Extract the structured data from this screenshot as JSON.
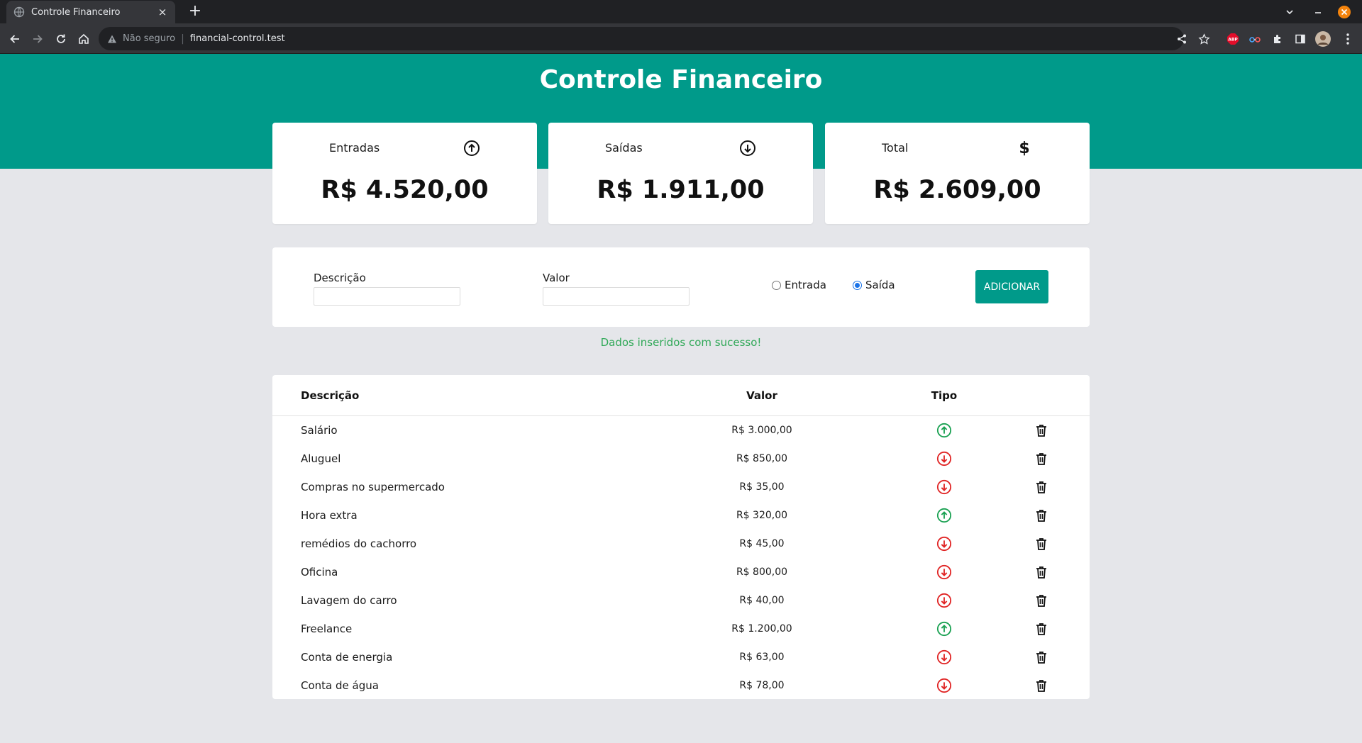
{
  "browser": {
    "tab_title": "Controle Financeiro",
    "tab_close": "×",
    "new_tab": "+",
    "security_label": "Não seguro",
    "url": "financial-control.test",
    "extension_badge": "ABP"
  },
  "header": {
    "title": "Controle Financeiro"
  },
  "summary": [
    {
      "label": "Entradas",
      "icon": "arrow-up-circle-icon",
      "value": "R$ 4.520,00"
    },
    {
      "label": "Saídas",
      "icon": "arrow-down-circle-icon",
      "value": "R$ 1.911,00"
    },
    {
      "label": "Total",
      "icon": "dollar-sign-icon",
      "icon_glyph": "$",
      "value": "R$ 2.609,00"
    }
  ],
  "form": {
    "description_label": "Descrição",
    "description_value": "",
    "amount_label": "Valor",
    "amount_value": "",
    "radio_income_label": "Entrada",
    "radio_expense_label": "Saída",
    "selected_type": "Saída",
    "add_button_label": "ADICIONAR"
  },
  "status_message": "Dados inseridos com sucesso!",
  "table": {
    "headers": {
      "description": "Descrição",
      "amount": "Valor",
      "type": "Tipo"
    },
    "rows": [
      {
        "description": "Salário",
        "amount": "R$ 3.000,00",
        "type": "entrada"
      },
      {
        "description": "Aluguel",
        "amount": "R$ 850,00",
        "type": "saida"
      },
      {
        "description": "Compras no supermercado",
        "amount": "R$ 35,00",
        "type": "saida"
      },
      {
        "description": "Hora extra",
        "amount": "R$ 320,00",
        "type": "entrada"
      },
      {
        "description": "remédios do cachorro",
        "amount": "R$ 45,00",
        "type": "saida"
      },
      {
        "description": "Oficina",
        "amount": "R$ 800,00",
        "type": "saida"
      },
      {
        "description": "Lavagem do carro",
        "amount": "R$ 40,00",
        "type": "saida"
      },
      {
        "description": "Freelance",
        "amount": "R$ 1.200,00",
        "type": "entrada"
      },
      {
        "description": "Conta de energia",
        "amount": "R$ 63,00",
        "type": "saida"
      },
      {
        "description": "Conta de água",
        "amount": "R$ 78,00",
        "type": "saida"
      }
    ]
  },
  "colors": {
    "brand": "#009a8a",
    "income": "#1aa152",
    "expense": "#e02424",
    "success_text": "#2fa857",
    "background": "#e5e6ea"
  }
}
